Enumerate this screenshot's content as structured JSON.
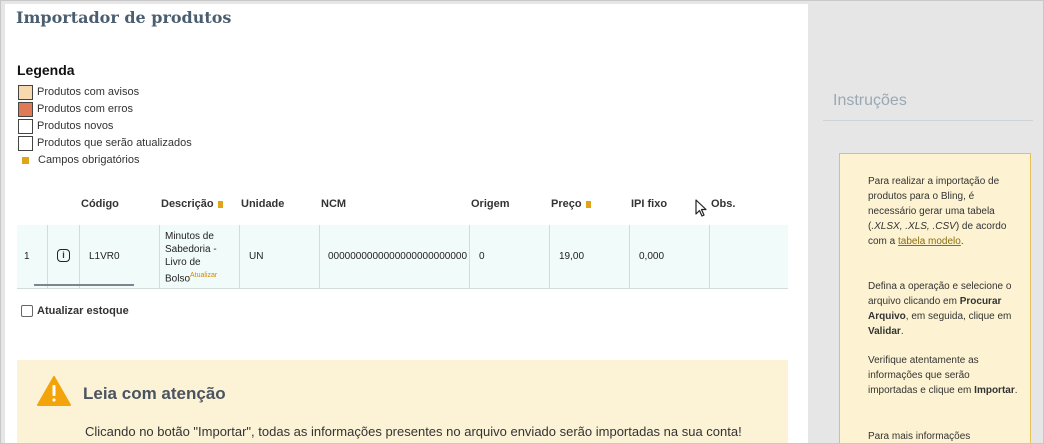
{
  "page": {
    "title": "Importador de produtos"
  },
  "legend": {
    "title": "Legenda",
    "items": [
      {
        "label": "Produtos com avisos",
        "color": "#f7d9b0"
      },
      {
        "label": "Produtos com erros",
        "color": "#e07a56"
      },
      {
        "label": "Produtos novos",
        "color": "#ffffff"
      },
      {
        "label": "Produtos que serão atualizados",
        "color": "#ffffff"
      }
    ],
    "required_label": "Campos obrigatórios",
    "required_color": "#e0a419"
  },
  "table": {
    "headers": {
      "codigo": "Código",
      "descricao": "Descrição",
      "unidade": "Unidade",
      "ncm": "NCM",
      "origem": "Origem",
      "preco": "Preço",
      "ipi": "IPI fixo",
      "obs": "Obs."
    },
    "rows": [
      {
        "index": "1",
        "codigo": "L1VR0",
        "descricao": "Minutos de Sabedoria - Livro de Bolso",
        "tag": "Atualizar",
        "unidade": "UN",
        "ncm": "0000000000000000000000000",
        "origem": "0",
        "preco": "19,00",
        "ipi": "0,000",
        "obs": ""
      }
    ]
  },
  "stock": {
    "label": "Atualizar estoque",
    "checked": false
  },
  "warning": {
    "title": "Leia com atenção",
    "text": "Clicando no botão \"Importar\", todas as informações presentes no arquivo enviado serão importadas na sua conta!"
  },
  "sidebar": {
    "title": "Instruções",
    "p1_a": "Para realizar a importação de produtos para o Bling, é necessário gerar uma tabela (",
    "p1_formats": ".XLSX, .XLS, .CSV",
    "p1_b": ") de acordo com a ",
    "p1_link": "tabela modelo",
    "p1_c": ".",
    "p2_a": "Defina a operação e selecione o arquivo clicando em ",
    "p2_bold1": "Procurar Arquivo",
    "p2_b": ", em seguida, clique em ",
    "p2_bold2": "Validar",
    "p2_c": ".",
    "p3_a": "Verifique atentamente as informações que serão importadas e clique em ",
    "p3_bold": "Importar",
    "p3_b": ".",
    "p4": "Para mais informações"
  }
}
